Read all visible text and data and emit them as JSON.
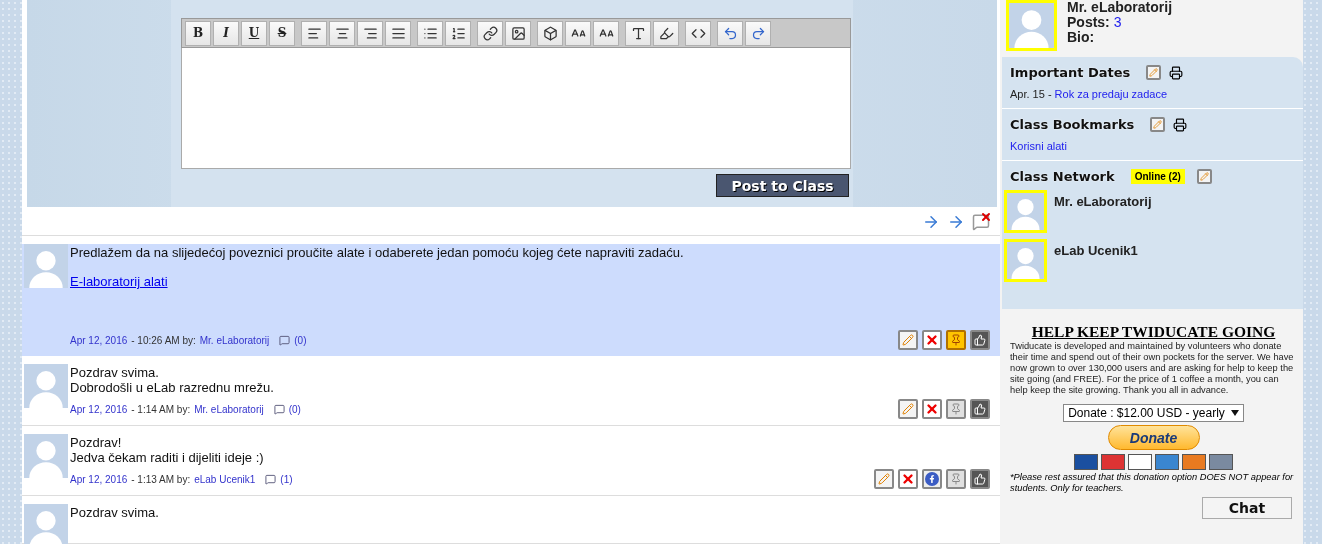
{
  "editor": {
    "format_buttons": [
      "B",
      "I",
      "U",
      "S"
    ],
    "post_button": "Post to Class"
  },
  "posts": [
    {
      "selected": true,
      "pinned": true,
      "facebook": false,
      "lines": [
        "Predlažem da na slijedećoj poveznici proučite alate i odaberete jedan pomoću kojeg ćete napraviti zadaću."
      ],
      "link": "E-laboratorij alati",
      "date": "Apr 12, 2016",
      "time": "- 10:26 AM by:",
      "author": "Mr. eLaboratorij",
      "comments": "(0)"
    },
    {
      "selected": false,
      "pinned": false,
      "facebook": false,
      "lines": [
        "Pozdrav svima.",
        "Dobrodošli u eLab razrednu mrežu."
      ],
      "date": "Apr 12, 2016",
      "time": "- 1:14 AM by:",
      "author": "Mr. eLaboratorij",
      "comments": "(0)"
    },
    {
      "selected": false,
      "pinned": false,
      "facebook": true,
      "lines": [
        "Pozdrav!",
        "Jedva čekam raditi i dijeliti ideje :)"
      ],
      "date": "Apr 12, 2016",
      "time": "- 1:13 AM by:",
      "author": "eLab Ucenik1",
      "comments": "(1)"
    },
    {
      "selected": false,
      "lines": [
        "Pozdrav svima."
      ]
    }
  ],
  "sidebar": {
    "profile": {
      "name": "Mr. eLaboratorij",
      "posts_label": "Posts:",
      "posts_count": "3",
      "bio_label": "Bio:"
    },
    "important_dates": {
      "title": "Important Dates",
      "items": [
        {
          "date": "Apr. 15 -",
          "text": "Rok za predaju zadace"
        }
      ]
    },
    "bookmarks": {
      "title": "Class Bookmarks",
      "items": [
        "Korisni alati"
      ]
    },
    "network": {
      "title": "Class Network",
      "online": "Online (2)",
      "members": [
        "Mr. eLaboratorij",
        "eLab Ucenik1"
      ]
    },
    "donate": {
      "heading": "HELP KEEP TWIDUCATE GOING",
      "text": "Twiducate is developed and maintained by volunteers who donate their time and spend out of their own pockets for the server. We have now grown to over 130,000 users and are asking for help to keep the site going (and FREE). For the price of 1 coffee a month, you can help keep the site growing. Thank you all in advance.",
      "select": "Donate : $12.00 USD - yearly",
      "button": "Donate",
      "note": "*Please rest assured that this donation option DOES NOT appear for students. Only for teachers."
    },
    "chat": "Chat"
  }
}
